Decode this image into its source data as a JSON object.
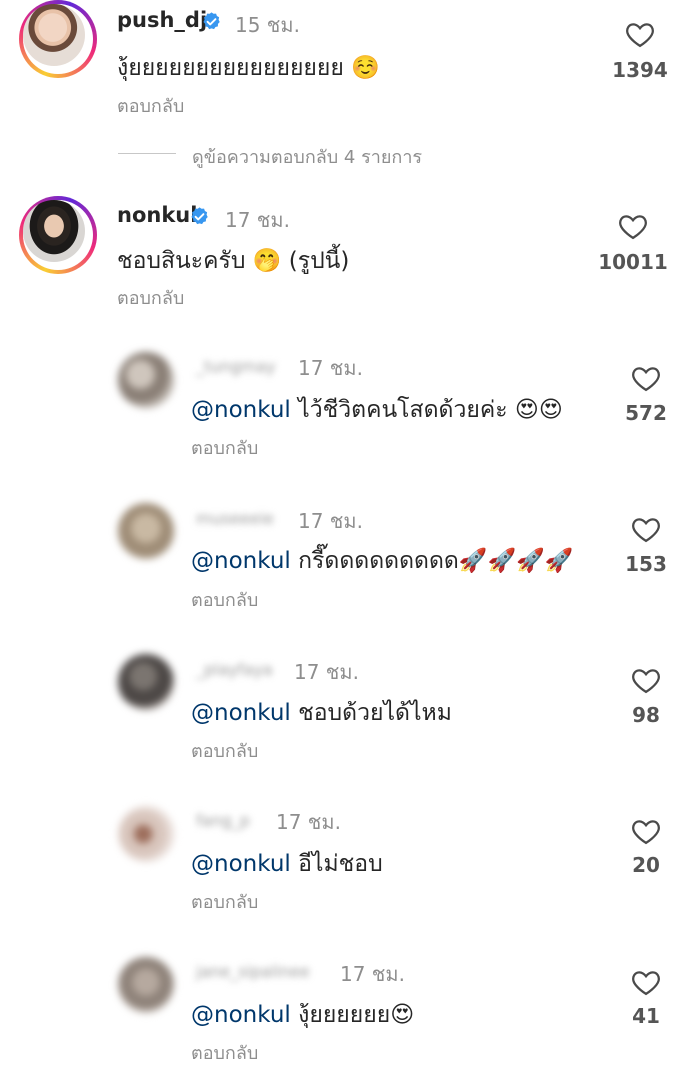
{
  "comments": [
    {
      "username": "push_dj",
      "verified": true,
      "time": "15 ชม.",
      "text": "งุ้ยยยยยยยยยยยยยยยย ☺️",
      "reply_label": "ตอบกลับ",
      "likes": "1394"
    },
    {
      "username": "nonkul",
      "verified": true,
      "time": "17 ชม.",
      "text": "ชอบสินะครับ 🤭 (รูปนี้)",
      "reply_label": "ตอบกลับ",
      "likes": "10011"
    }
  ],
  "view_replies": "ดูข้อความตอบกลับ 4 รายการ",
  "replies": [
    {
      "username": "_tungmay",
      "time": "17 ชม.",
      "mention": "@nonkul",
      "text": " ไว้ชีวิตคนโสดด้วยค่ะ 😍😍",
      "reply_label": "ตอบกลับ",
      "likes": "572"
    },
    {
      "username": "museeeie",
      "time": "17 ชม.",
      "mention": "@nonkul",
      "text": " กรี๊ดดดดดดดดด🚀🚀🚀🚀",
      "reply_label": "ตอบกลับ",
      "likes": "153"
    },
    {
      "username": "_playfaya",
      "time": "17 ชม.",
      "mention": "@nonkul",
      "text": " ชอบด้วยได้ไหม",
      "reply_label": "ตอบกลับ",
      "likes": "98"
    },
    {
      "username": "fang_p",
      "time": "17 ชม.",
      "mention": "@nonkul",
      "text": " อีไม่ชอบ",
      "reply_label": "ตอบกลับ",
      "likes": "20"
    },
    {
      "username": "jane_sipalinee",
      "time": "17 ชม.",
      "mention": "@nonkul",
      "text": " งุ้ยยยยยย😍",
      "reply_label": "ตอบกลับ",
      "likes": "41"
    }
  ],
  "colors": {
    "mention": "#00376b",
    "verified": "#3897f0",
    "muted": "#8e8e8e"
  }
}
